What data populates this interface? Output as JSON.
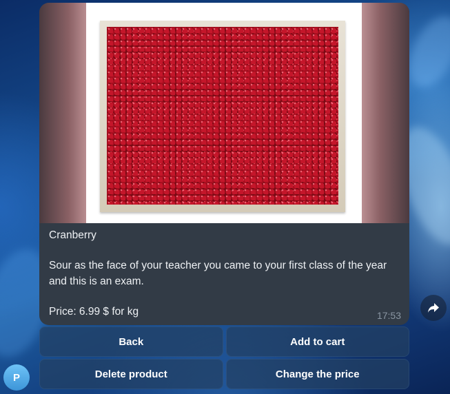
{
  "product": {
    "name": "Cranberry",
    "description": "Sour as the face of your teacher you came to your first class of the year and this is an exam.",
    "price_line": "Price: 6.99 $ for kg",
    "time": "17:53",
    "photo_subject": "crate of cranberries"
  },
  "keyboard": {
    "rows": [
      [
        {
          "label": "Back"
        },
        {
          "label": "Add to cart"
        }
      ],
      [
        {
          "label": "Delete product"
        },
        {
          "label": "Change the price"
        }
      ]
    ]
  },
  "sender": {
    "avatar_letter": "P"
  },
  "icons": {
    "share": "share-arrow-icon"
  },
  "colors": {
    "bubble": "#323b46",
    "button": "#224062",
    "avatar": "#4fa8e6",
    "timestamp": "#8a96a3"
  }
}
